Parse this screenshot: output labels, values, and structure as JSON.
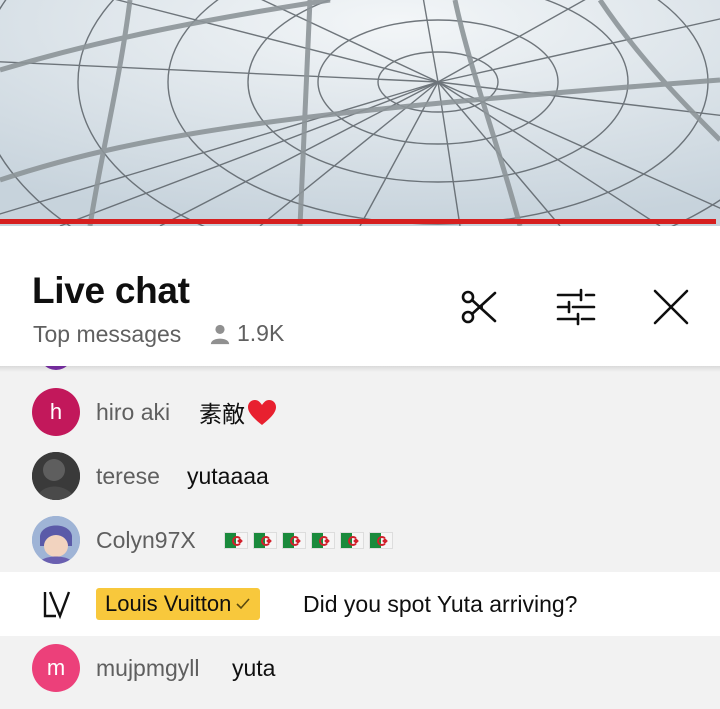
{
  "video": {
    "progress_percent": 99.4,
    "progress_color": "#d61f1f"
  },
  "live_chat": {
    "title": "Live chat",
    "mode": "Top messages",
    "viewer_count": "1.9K",
    "actions": [
      "clip-icon",
      "filter-sliders-icon",
      "close-icon"
    ]
  },
  "messages": [
    {
      "author": "hiro aki",
      "avatar_letter": "h",
      "avatar_color": "#c2185b",
      "text": "素敵",
      "emoji": "heart"
    },
    {
      "author": "terese",
      "avatar_letter": "",
      "avatar_color": "#2a2a2a",
      "text": "yutaaaa"
    },
    {
      "author": "Colyn97X",
      "avatar_letter": "",
      "avatar_color": "#8fa8cf",
      "text": "",
      "flag_count": 6,
      "flag": "algeria-flag"
    },
    {
      "author": "Louis Vuitton",
      "verified": true,
      "member_badge_color": "#f8c83c",
      "avatar_letter": "LV",
      "avatar_color": "#ffffff",
      "text": "Did you spot Yuta arriving?",
      "highlighted": true
    },
    {
      "author": "mujpmgyll",
      "avatar_letter": "m",
      "avatar_color": "#ec407a",
      "text": "yuta"
    }
  ]
}
